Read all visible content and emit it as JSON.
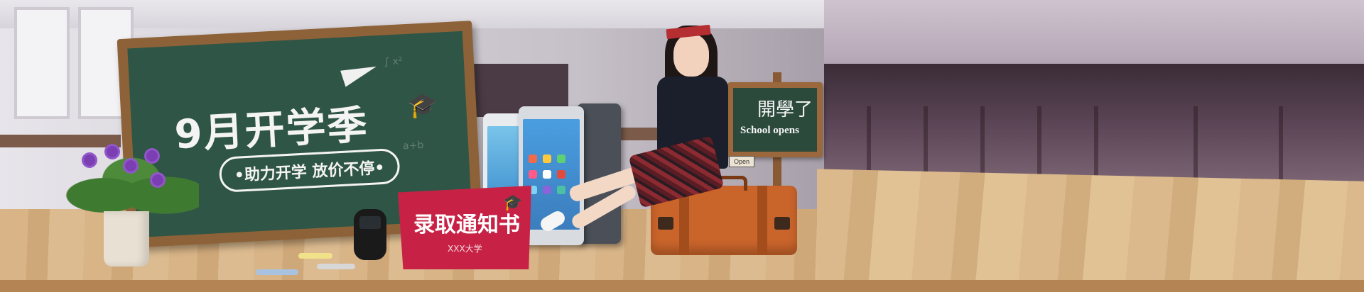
{
  "banner": {
    "board_title": "9月开学季",
    "board_subtitle": "•助力开学 放价不停•",
    "notice_card": {
      "title": "录取通知书",
      "subtitle": "XXX大学"
    },
    "school_sign": {
      "title_cn": "開學了",
      "title_en": "School opens",
      "tag": "Open"
    }
  },
  "colors": {
    "chalkboard": "#2f5546",
    "board_frame": "#8d6238",
    "card": "#c72245",
    "suitcase": "#c9642b",
    "table": "#d8b487"
  },
  "icons": [
    "paper-plane-icon",
    "graduation-cap-icon"
  ]
}
